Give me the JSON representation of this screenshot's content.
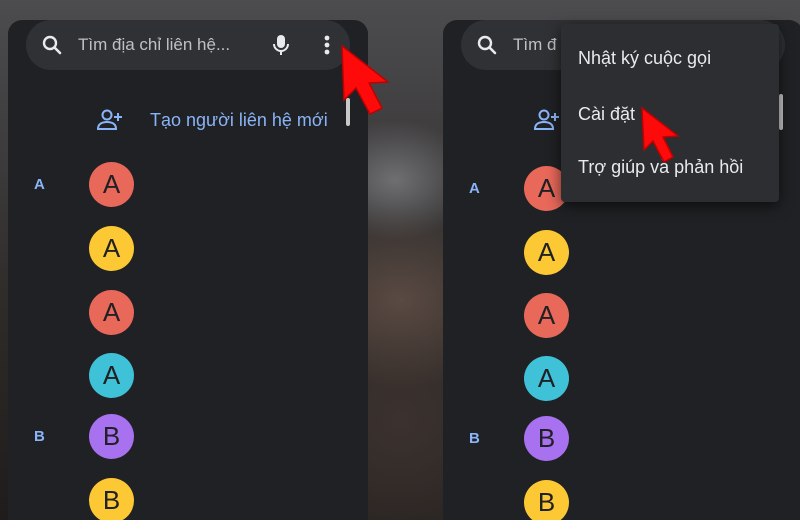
{
  "search": {
    "placeholder_left": "Tìm địa chỉ liên hệ...",
    "placeholder_right": "Tìm đ"
  },
  "create_contact": {
    "label": "Tạo người liên hệ mới"
  },
  "sections": [
    {
      "letter": "A",
      "avatars": [
        {
          "letter": "A",
          "color": "#e8685a"
        },
        {
          "letter": "A",
          "color": "#fcc934"
        },
        {
          "letter": "A",
          "color": "#e8685a"
        },
        {
          "letter": "A",
          "color": "#3fc1d8"
        }
      ]
    },
    {
      "letter": "B",
      "avatars": [
        {
          "letter": "B",
          "color": "#a771ef"
        },
        {
          "letter": "B",
          "color": "#fcc934"
        }
      ]
    }
  ],
  "overflow_menu": {
    "items": [
      {
        "label": "Nhật ký cuộc gọi"
      },
      {
        "label": "Cài đặt"
      },
      {
        "label": "Trợ giúp và phản hồi"
      }
    ]
  },
  "icons": {
    "search": "search-icon",
    "mic": "mic-icon",
    "more": "more-vert-icon",
    "add_person": "person-add-icon",
    "pointer": "red-arrow-cursor-icon"
  },
  "colors": {
    "accent": "#8ab4f8",
    "background": "#202124",
    "searchbar": "#303134",
    "cursor": "#ff0a0a"
  }
}
